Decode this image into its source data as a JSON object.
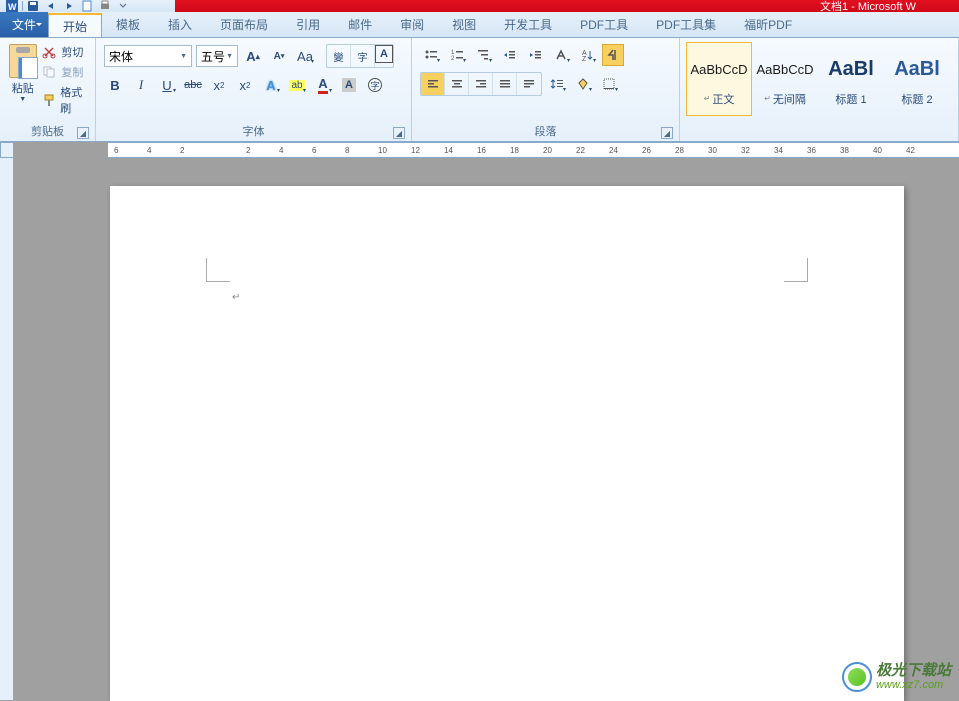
{
  "titlebar": {
    "title": "文档1 - Microsoft W"
  },
  "tabs": {
    "file": "文件",
    "items": [
      "开始",
      "模板",
      "插入",
      "页面布局",
      "引用",
      "邮件",
      "审阅",
      "视图",
      "开发工具",
      "PDF工具",
      "PDF工具集",
      "福昕PDF"
    ],
    "active_index": 0
  },
  "clipboard": {
    "paste": "粘贴",
    "cut": "剪切",
    "copy": "复制",
    "format_painter": "格式刷",
    "label": "剪贴板"
  },
  "font": {
    "family": "宋体",
    "size": "五号",
    "label": "字体"
  },
  "paragraph": {
    "label": "段落"
  },
  "styles": {
    "items": [
      {
        "preview": "AaBbCcD",
        "name": "正文",
        "variant": "normal",
        "selected": true
      },
      {
        "preview": "AaBbCcD",
        "name": "无间隔",
        "variant": "normal"
      },
      {
        "preview": "AaBl",
        "name": "标题 1",
        "variant": "big"
      },
      {
        "preview": "AaBl",
        "name": "标题 2",
        "variant": "blue"
      }
    ]
  },
  "ruler": {
    "ticks": [
      "6",
      "4",
      "2",
      "",
      "2",
      "4",
      "6",
      "8",
      "10",
      "12",
      "14",
      "16",
      "18",
      "20",
      "22",
      "24",
      "26",
      "28",
      "30",
      "32",
      "34",
      "36",
      "38",
      "40",
      "42"
    ]
  },
  "watermark": {
    "cn": "极光下载站",
    "en": "www.xz7.com"
  }
}
